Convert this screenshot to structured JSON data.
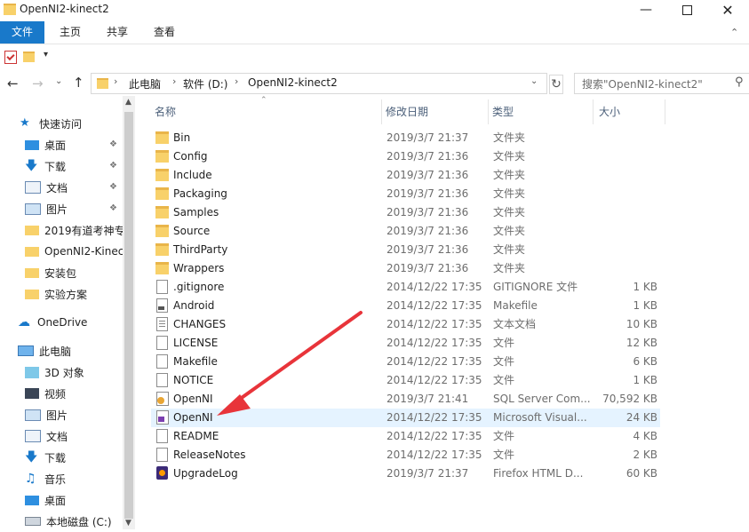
{
  "window": {
    "title": "OpenNI2-kinect2"
  },
  "ribbon": {
    "tabs": [
      "文件",
      "主页",
      "共享",
      "查看"
    ]
  },
  "address": {
    "crumbs": [
      "此电脑",
      "软件 (D:)",
      "OpenNI2-kinect2"
    ]
  },
  "search": {
    "placeholder": "搜索\"OpenNI2-kinect2\""
  },
  "nav": {
    "quick_access": "快速访问",
    "quick_items": [
      "桌面",
      "下载",
      "文档",
      "图片",
      "2019有道考神专",
      "OpenNI2-Kinec",
      "安装包",
      "实验方案"
    ],
    "onedrive": "OneDrive",
    "this_pc": "此电脑",
    "pc_items": [
      "3D 对象",
      "视频",
      "图片",
      "文档",
      "下载",
      "音乐",
      "桌面",
      "本地磁盘 (C:)"
    ]
  },
  "columns": {
    "name": "名称",
    "date": "修改日期",
    "type": "类型",
    "size": "大小"
  },
  "files": [
    {
      "name": "Bin",
      "date": "2019/3/7 21:37",
      "type": "文件夹",
      "size": "",
      "icon": "folder-icon"
    },
    {
      "name": "Config",
      "date": "2019/3/7 21:36",
      "type": "文件夹",
      "size": "",
      "icon": "folder-icon"
    },
    {
      "name": "Include",
      "date": "2019/3/7 21:36",
      "type": "文件夹",
      "size": "",
      "icon": "folder-icon"
    },
    {
      "name": "Packaging",
      "date": "2019/3/7 21:36",
      "type": "文件夹",
      "size": "",
      "icon": "folder-icon"
    },
    {
      "name": "Samples",
      "date": "2019/3/7 21:36",
      "type": "文件夹",
      "size": "",
      "icon": "folder-icon"
    },
    {
      "name": "Source",
      "date": "2019/3/7 21:36",
      "type": "文件夹",
      "size": "",
      "icon": "folder-icon"
    },
    {
      "name": "ThirdParty",
      "date": "2019/3/7 21:36",
      "type": "文件夹",
      "size": "",
      "icon": "folder-icon"
    },
    {
      "name": "Wrappers",
      "date": "2019/3/7 21:36",
      "type": "文件夹",
      "size": "",
      "icon": "folder-icon"
    },
    {
      "name": ".gitignore",
      "date": "2014/12/22 17:35",
      "type": "GITIGNORE 文件",
      "size": "1 KB",
      "icon": "file-icon"
    },
    {
      "name": "Android",
      "date": "2014/12/22 17:35",
      "type": "Makefile",
      "size": "1 KB",
      "icon": "makefile-icon"
    },
    {
      "name": "CHANGES",
      "date": "2014/12/22 17:35",
      "type": "文本文档",
      "size": "10 KB",
      "icon": "text-file-icon"
    },
    {
      "name": "LICENSE",
      "date": "2014/12/22 17:35",
      "type": "文件",
      "size": "12 KB",
      "icon": "file-icon"
    },
    {
      "name": "Makefile",
      "date": "2014/12/22 17:35",
      "type": "文件",
      "size": "6 KB",
      "icon": "file-icon"
    },
    {
      "name": "NOTICE",
      "date": "2014/12/22 17:35",
      "type": "文件",
      "size": "1 KB",
      "icon": "file-icon"
    },
    {
      "name": "OpenNI",
      "date": "2019/3/7 21:41",
      "type": "SQL Server Com...",
      "size": "70,592 KB",
      "icon": "sql-db-icon"
    },
    {
      "name": "OpenNI",
      "date": "2014/12/22 17:35",
      "type": "Microsoft Visual...",
      "size": "24 KB",
      "icon": "visual-studio-icon",
      "selected": true
    },
    {
      "name": "README",
      "date": "2014/12/22 17:35",
      "type": "文件",
      "size": "4 KB",
      "icon": "file-icon"
    },
    {
      "name": "ReleaseNotes",
      "date": "2014/12/22 17:35",
      "type": "文件",
      "size": "2 KB",
      "icon": "file-icon"
    },
    {
      "name": "UpgradeLog",
      "date": "2019/3/7 21:37",
      "type": "Firefox HTML D...",
      "size": "60 KB",
      "icon": "firefox-html-icon"
    }
  ],
  "colors": {
    "accent": "#1979ca",
    "selection": "#e5f3ff",
    "annotation_arrow": "#e8343a"
  }
}
